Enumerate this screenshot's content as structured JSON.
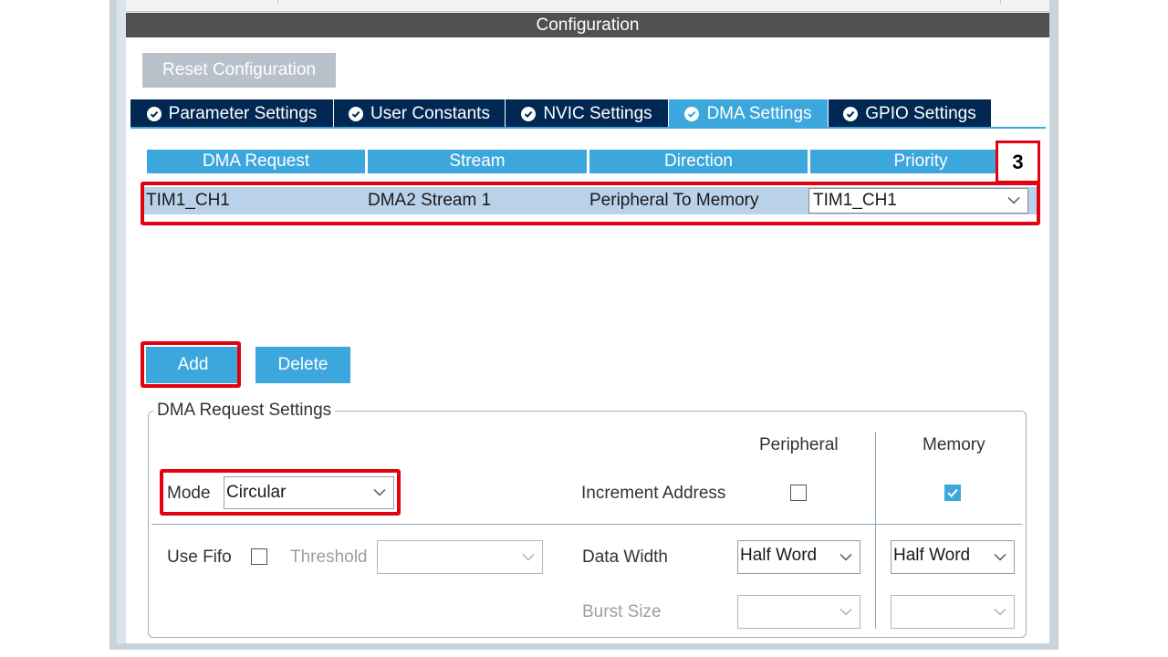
{
  "header": {
    "title": "Configuration"
  },
  "toolbar": {
    "reset_label": "Reset Configuration"
  },
  "tabs": [
    {
      "label": "Parameter Settings",
      "icon": "check-circle-icon",
      "active": false
    },
    {
      "label": "User Constants",
      "icon": "check-circle-icon",
      "active": false
    },
    {
      "label": "NVIC Settings",
      "icon": "check-circle-icon",
      "active": false
    },
    {
      "label": "DMA Settings",
      "icon": "check-circle-icon",
      "active": true
    },
    {
      "label": "GPIO Settings",
      "icon": "check-circle-icon",
      "active": false
    }
  ],
  "dma_table": {
    "columns": [
      "DMA Request",
      "Stream",
      "Direction",
      "Priority"
    ],
    "rows": [
      {
        "request": "TIM1_CH1",
        "stream": "DMA2 Stream 1",
        "direction": "Peripheral To Memory",
        "priority": "TIM1_CH1"
      }
    ]
  },
  "annotation": {
    "step": "3"
  },
  "actions": {
    "add_label": "Add",
    "delete_label": "Delete"
  },
  "settings": {
    "group_title": "DMA Request Settings",
    "mode_label": "Mode",
    "mode_value": "Circular",
    "peripheral_header": "Peripheral",
    "memory_header": "Memory",
    "increment_label": "Increment Address",
    "peripheral_increment": false,
    "memory_increment": true,
    "use_fifo_label": "Use Fifo",
    "use_fifo": false,
    "threshold_label": "Threshold",
    "threshold_value": "",
    "data_width_label": "Data Width",
    "peripheral_data_width": "Half Word",
    "memory_data_width": "Half Word",
    "burst_size_label": "Burst Size",
    "peripheral_burst": "",
    "memory_burst": ""
  },
  "colors": {
    "accent": "#3ca7dc",
    "tab_dark": "#002852",
    "highlight_red": "#e3000f",
    "row_selected": "#b9d1e9"
  }
}
